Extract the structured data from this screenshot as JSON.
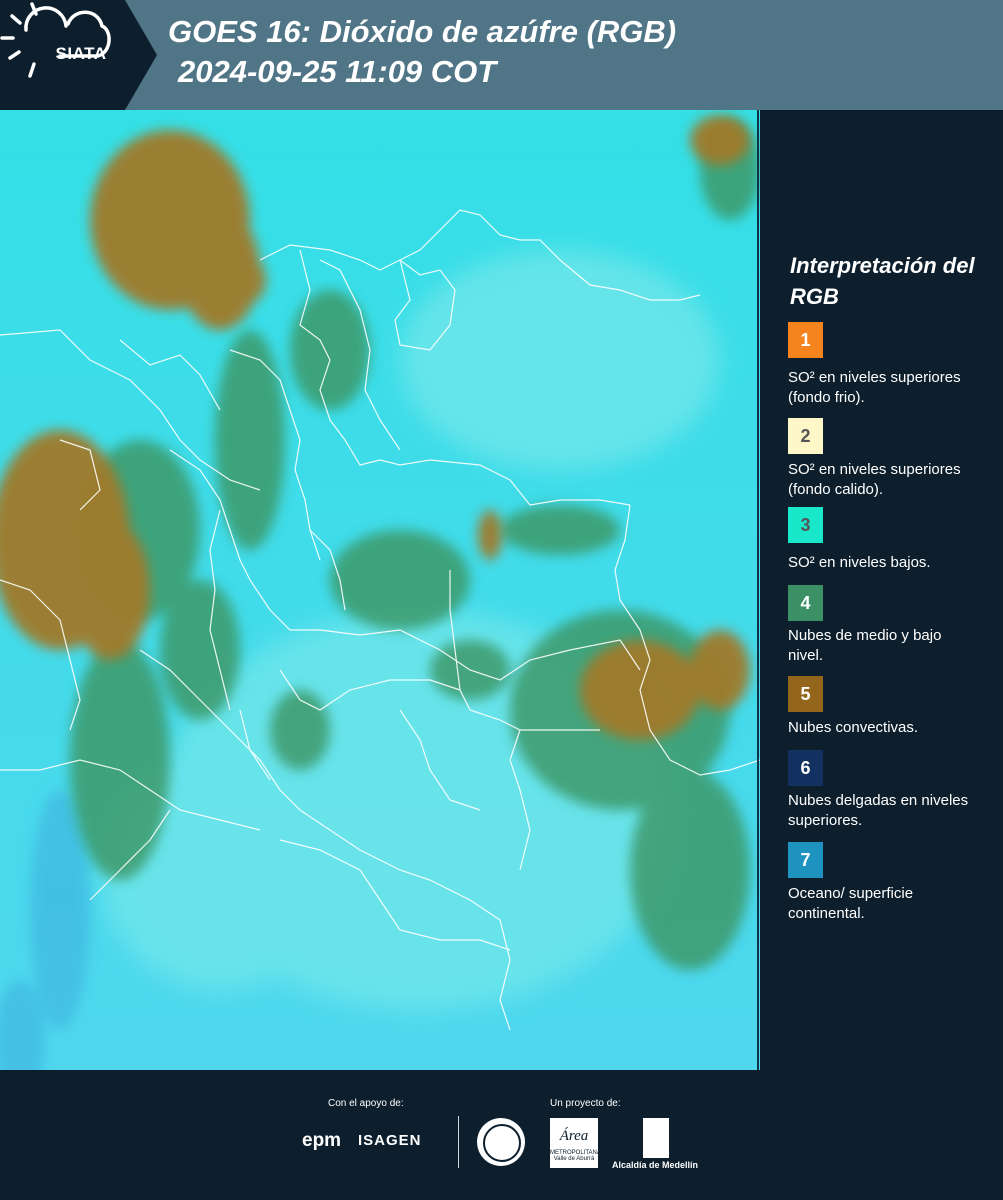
{
  "header": {
    "logo_text": "SIATA",
    "title_line1": "GOES 16: Dióxido de azúfre (RGB)",
    "title_line2": "2024-09-25 11:09 COT",
    "bg_color": "#4f7586",
    "logo_bg_color": "#0d1f2d"
  },
  "legend": {
    "title": "Interpretación del RGB",
    "items": [
      {
        "number": "1",
        "color": "#f5841f",
        "label": "SO² en niveles superiores (fondo frio)."
      },
      {
        "number": "2",
        "color": "#fef7c8",
        "label": "SO² en niveles superiores (fondo calido)."
      },
      {
        "number": "3",
        "color": "#19e7c9",
        "label": "SO² en niveles bajos."
      },
      {
        "number": "4",
        "color": "#3b9066",
        "label": "Nubes de medio y bajo nivel."
      },
      {
        "number": "5",
        "color": "#93661c",
        "label": "Nubes convectivas."
      },
      {
        "number": "6",
        "color": "#123160",
        "label": "Nubes delgadas en niveles superiores."
      },
      {
        "number": "7",
        "color": "#1f93c0",
        "label": "Oceano/ superficie continental."
      }
    ]
  },
  "footer": {
    "support_label": "Con el apoyo de:",
    "project_label": "Un proyecto de:",
    "epm": "epm",
    "isagen": "ISAGEN",
    "area_word": "Área",
    "area_sub": "METROPOLITANA Valle de Aburrá",
    "alcaldia": "Alcaldía de Medellín"
  }
}
